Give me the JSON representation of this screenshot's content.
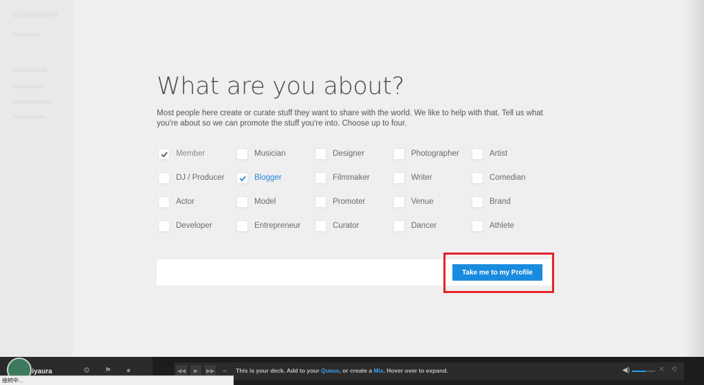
{
  "sidebar": {
    "logo": "somewhere"
  },
  "page": {
    "title": "What are you about?",
    "intro": "Most people here create or curate stuff they want to share with the world. We like to help with that. Tell us what you're about so we can promote the stuff you're into. Choose up to four."
  },
  "options": [
    {
      "label": "Member",
      "checked": true,
      "style": "grey"
    },
    {
      "label": "Musician",
      "checked": false
    },
    {
      "label": "Designer",
      "checked": false
    },
    {
      "label": "Photographer",
      "checked": false
    },
    {
      "label": "Artist",
      "checked": false
    },
    {
      "label": "DJ / Producer",
      "checked": false
    },
    {
      "label": "Blogger",
      "checked": true,
      "style": "blue"
    },
    {
      "label": "Filmmaker",
      "checked": false
    },
    {
      "label": "Writer",
      "checked": false
    },
    {
      "label": "Comedian",
      "checked": false
    },
    {
      "label": "Actor",
      "checked": false
    },
    {
      "label": "Model",
      "checked": false
    },
    {
      "label": "Promoter",
      "checked": false
    },
    {
      "label": "Venue",
      "checked": false
    },
    {
      "label": "Brand",
      "checked": false
    },
    {
      "label": "Developer",
      "checked": false
    },
    {
      "label": "Entrepreneur",
      "checked": false
    },
    {
      "label": "Curator",
      "checked": false
    },
    {
      "label": "Dancer",
      "checked": false
    },
    {
      "label": "Athlete",
      "checked": false
    }
  ],
  "submit": {
    "label": "Take me to my Profile"
  },
  "bottom": {
    "username": "Miyaura",
    "deck_prefix": "This is your deck. Add to your ",
    "deck_queue": "Queue",
    "deck_middle": ", or create a ",
    "deck_mix": "Mix",
    "deck_suffix": ". Hover over to expand.",
    "volume_level": 0.6
  },
  "status_bar": "接続中...",
  "colors": {
    "accent": "#1a8ce0",
    "highlight": "#e5202a",
    "checked_blue": "#2a84d9",
    "bottom_bar": "#1c1c1c"
  }
}
